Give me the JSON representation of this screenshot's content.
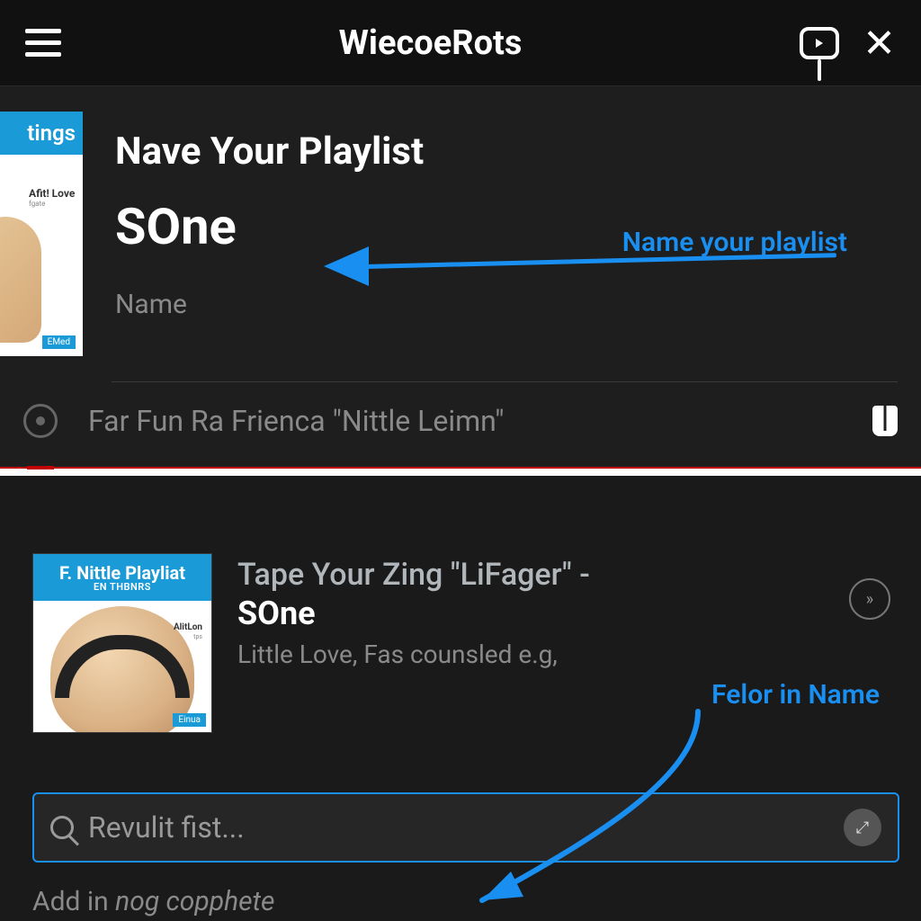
{
  "header": {
    "title": "WiecoeRots"
  },
  "top": {
    "album": {
      "band": "tings",
      "label": "Afit! Love",
      "sub": "fgate",
      "badge": "EMed"
    },
    "heading": "Nave Your Playlist",
    "big_name": "SOne",
    "field_label": "Name",
    "annotation": "Name your playlist",
    "partial": "Far Fun Ra Frienca \"Nittle Leimn\""
  },
  "bottom": {
    "album": {
      "band_top": "F. Nittle Playliat",
      "band_sub": "EN THBNRS",
      "la": "AlitLon",
      "lb": "tps",
      "badge": "Einua"
    },
    "line_a": "Tape Your Zing \"LiFager\" -",
    "line_b": "SOne",
    "line_c": "Little Love, Fas counsled e.g,",
    "annotation": "Felor in Name",
    "search_placeholder": "Revulit fist...",
    "add_prefix": "Add in ",
    "add_italic": "nog copphete"
  }
}
